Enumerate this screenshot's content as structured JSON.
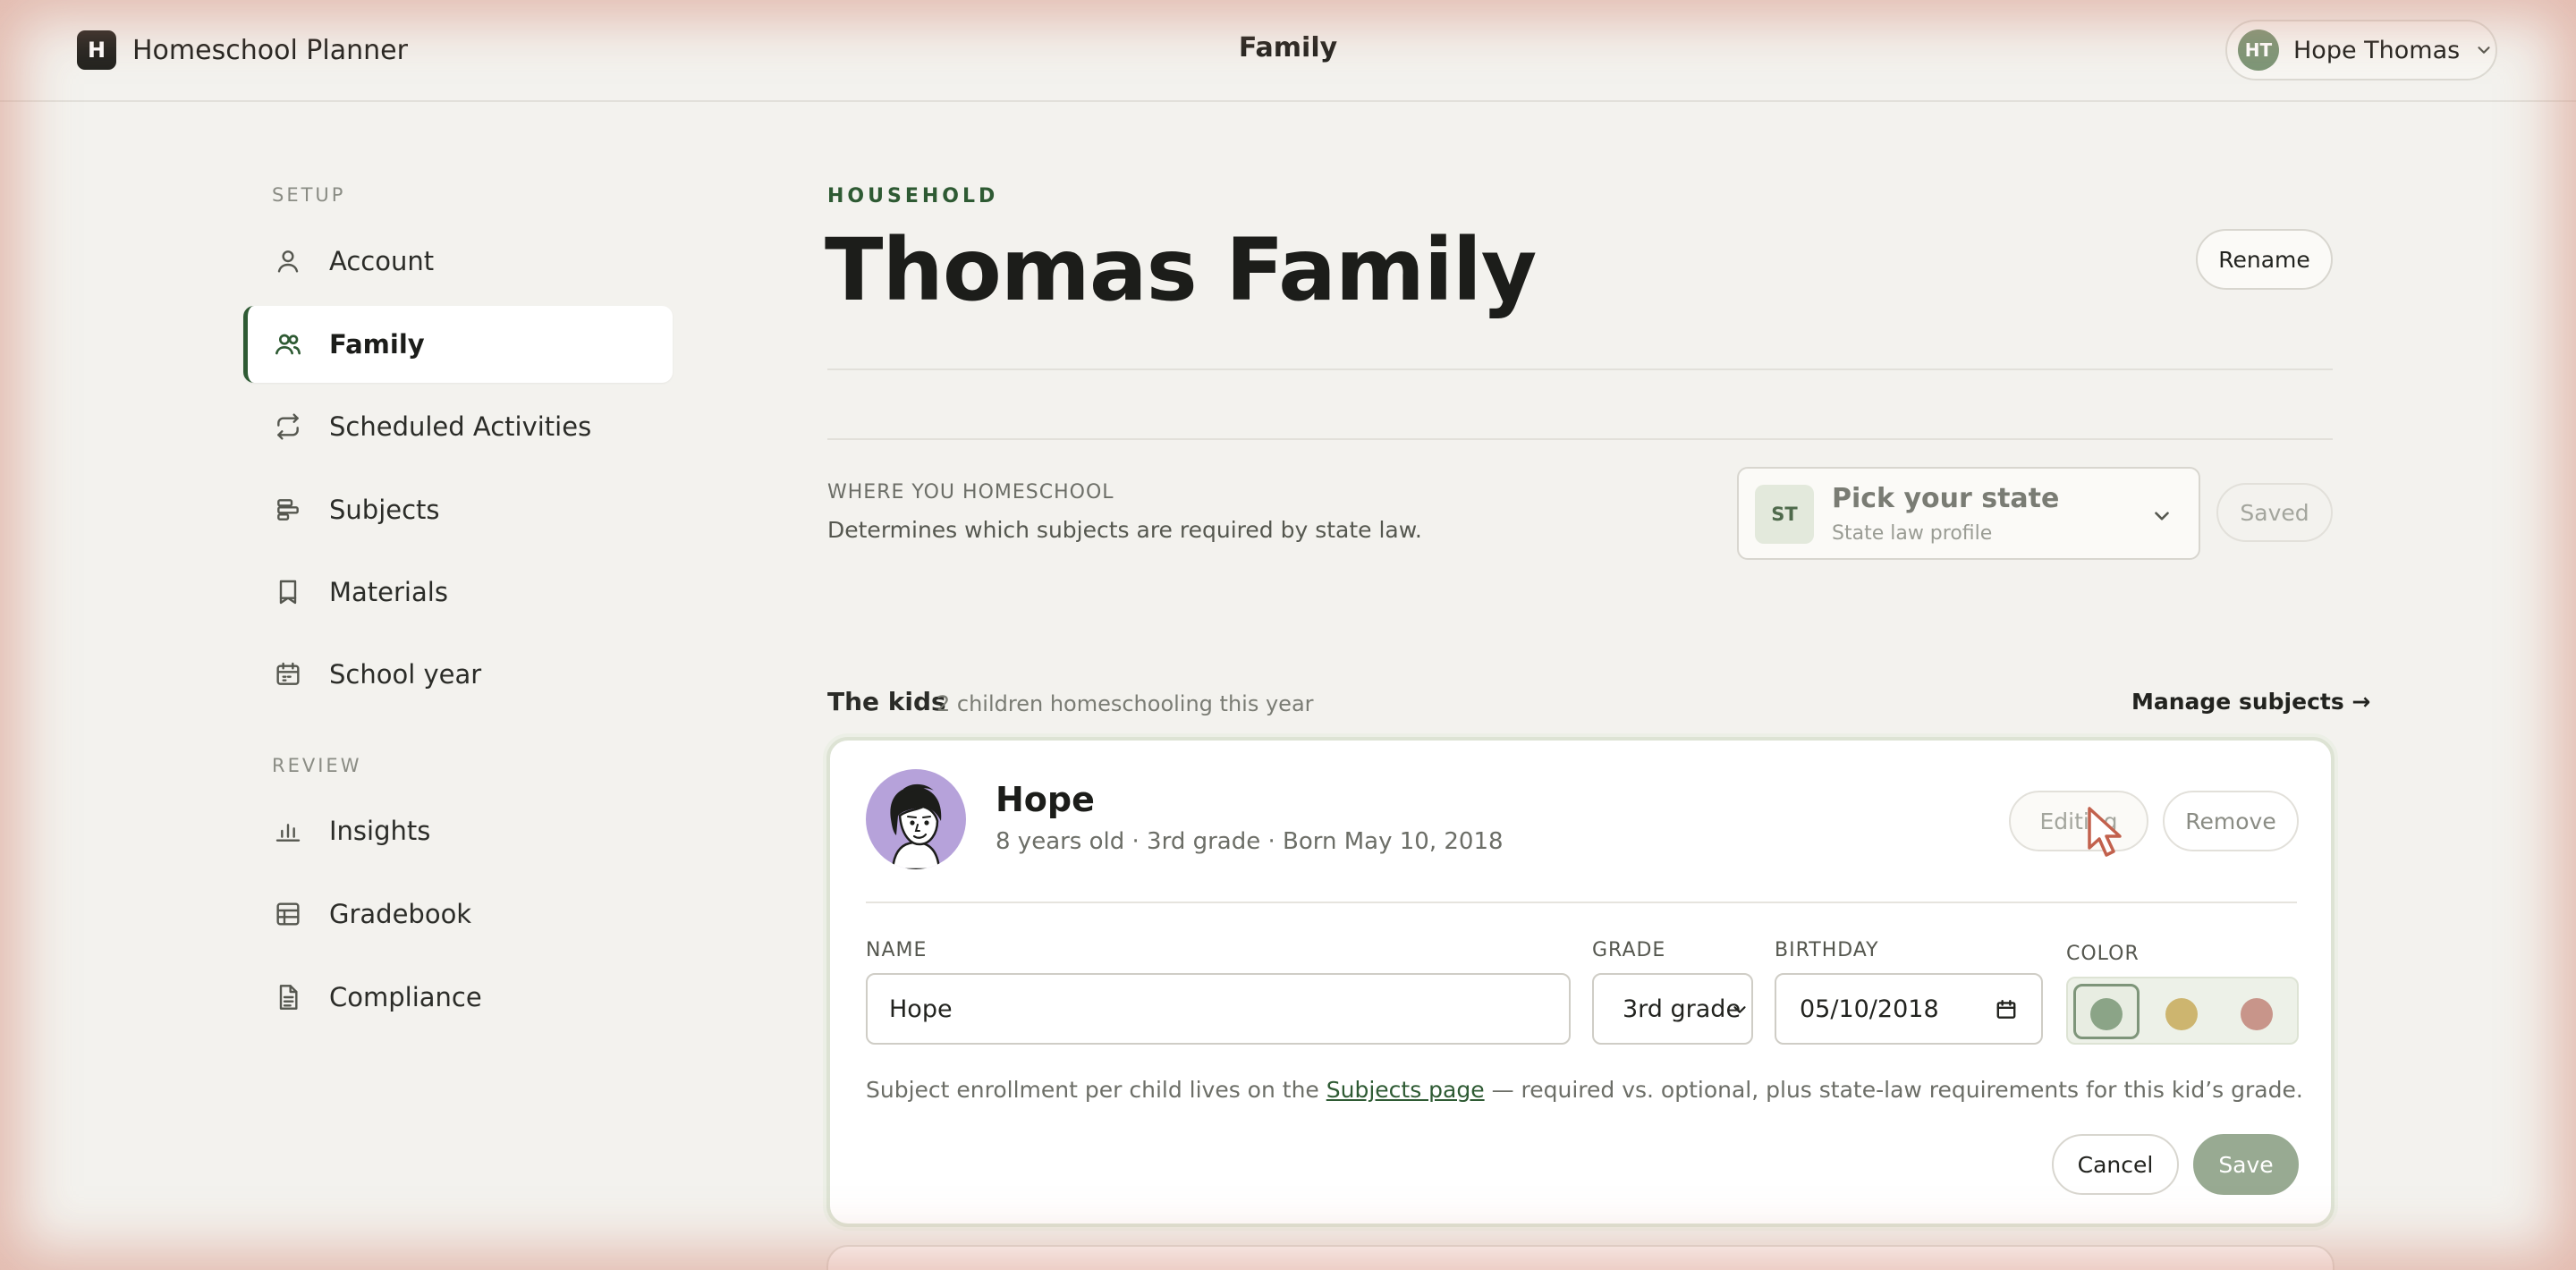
{
  "app": {
    "logo_letter": "H",
    "name": "Homeschool Planner"
  },
  "header": {
    "title": "Family"
  },
  "user": {
    "initials": "HT",
    "name": "Hope Thomas"
  },
  "sidebar": {
    "setup_heading": "SETUP",
    "review_heading": "REVIEW",
    "items": [
      {
        "label": "Account",
        "icon": "user-icon"
      },
      {
        "label": "Family",
        "icon": "users-icon",
        "active": true
      },
      {
        "label": "Scheduled Activities",
        "icon": "repeat-icon"
      },
      {
        "label": "Subjects",
        "icon": "subjects-icon"
      },
      {
        "label": "Materials",
        "icon": "bookmark-icon"
      },
      {
        "label": "School year",
        "icon": "calendar-icon"
      },
      {
        "label": "Insights",
        "icon": "bar-chart-icon"
      },
      {
        "label": "Gradebook",
        "icon": "table-icon"
      },
      {
        "label": "Compliance",
        "icon": "document-icon"
      }
    ]
  },
  "household": {
    "eyebrow": "HOUSEHOLD",
    "title": "Thomas Family",
    "rename_label": "Rename"
  },
  "where": {
    "label": "WHERE YOU HOMESCHOOL",
    "description": "Determines which subjects are required by state law.",
    "state_badge": "ST",
    "state_title": "Pick your state",
    "state_subtitle": "State law profile",
    "saved_label": "Saved"
  },
  "kids": {
    "title": "The kids",
    "count_text": "2 children homeschooling this year",
    "manage_link": "Manage subjects →",
    "card": {
      "name": "Hope",
      "meta": "8 years old · 3rd grade · Born May 10, 2018",
      "editing_label": "Editing",
      "remove_label": "Remove",
      "name_label": "NAME",
      "name_value": "Hope",
      "grade_label": "GRADE",
      "grade_value": "3rd grade",
      "birthday_label": "BIRTHDAY",
      "birthday_value": "05/10/2018",
      "color_label": "COLOR",
      "colors": [
        "#8ba487",
        "#cdb56f",
        "#c8958a"
      ],
      "selected_color": "#8ba487",
      "hint_before": "Subject enrollment per child lives on the ",
      "hint_link": "Subjects page",
      "hint_after": " — required vs. optional, plus state-law requirements for this kid’s grade.",
      "cancel_label": "Cancel",
      "save_label": "Save"
    }
  },
  "theme": {
    "accent": "#2e5a33",
    "save_button": "#98aa92",
    "avatar": "#b6a2da"
  }
}
